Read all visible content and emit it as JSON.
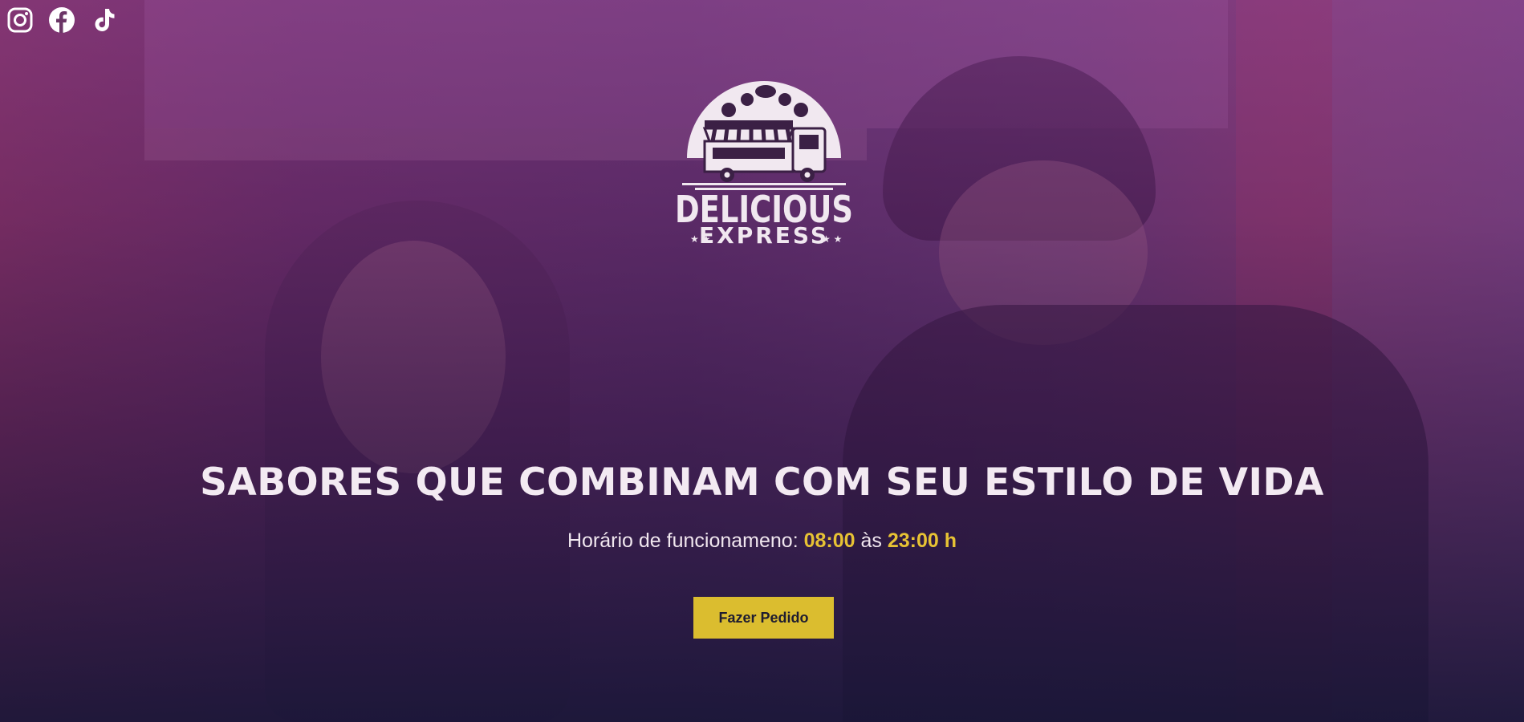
{
  "social": {
    "icons": [
      "instagram-icon",
      "facebook-icon",
      "tiktok-icon"
    ]
  },
  "logo": {
    "line1": "DELICIOUS",
    "line2": "EXPRESS",
    "icon": "food-truck-icon"
  },
  "hero": {
    "headline": "SABORES QUE COMBINAM COM SEU ESTILO DE VIDA",
    "hours_label": "Horário de funcionameno:",
    "open_time": "08:00",
    "connector": "às",
    "close_time": "23:00 h",
    "cta_label": "Fazer Pedido"
  },
  "colors": {
    "accent": "#dbbd2f",
    "text": "#f3eaf2",
    "overlay_top": "#8c3c8c",
    "overlay_bottom": "#191637"
  }
}
